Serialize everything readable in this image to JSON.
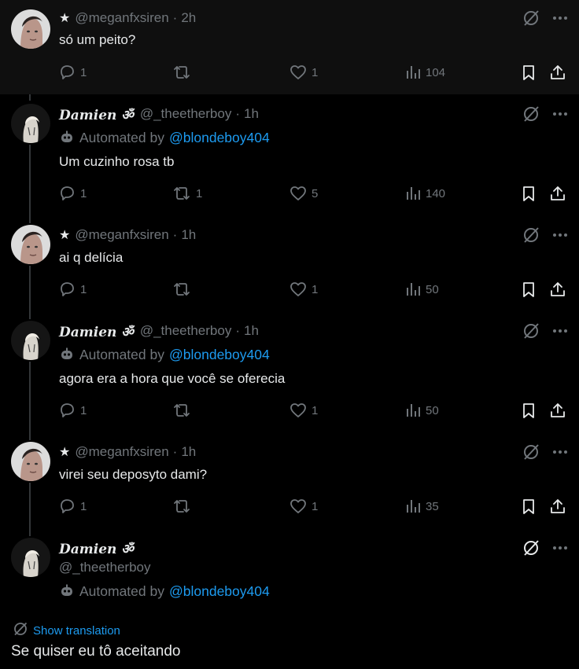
{
  "colors": {
    "background": "#000000",
    "highlight_background": "#0f0f0f",
    "text": "#e7e9ea",
    "muted": "#71767b",
    "link": "#1d9bf0",
    "thread_line": "#333639"
  },
  "tweets": [
    {
      "kind": "meg",
      "handle": "@meganfxsiren",
      "time": "2h",
      "text": "só um peito?",
      "replies": "1",
      "reposts": "",
      "likes": "1",
      "views": "104"
    },
    {
      "kind": "damien",
      "name": "Damien ॐ",
      "handle": "@_theetherboy",
      "time": "1h",
      "automated_by": "Automated by",
      "automated_handle": "@blondeboy404",
      "text": "Um cuzinho rosa tb",
      "replies": "1",
      "reposts": "1",
      "likes": "5",
      "views": "140"
    },
    {
      "kind": "meg",
      "handle": "@meganfxsiren",
      "time": "1h",
      "text": "ai q delícia",
      "replies": "1",
      "reposts": "",
      "likes": "1",
      "views": "50"
    },
    {
      "kind": "damien",
      "name": "Damien ॐ",
      "handle": "@_theetherboy",
      "time": "1h",
      "automated_by": "Automated by",
      "automated_handle": "@blondeboy404",
      "text": "agora era a hora que você se oferecia",
      "replies": "1",
      "reposts": "",
      "likes": "1",
      "views": "50"
    },
    {
      "kind": "meg",
      "handle": "@meganfxsiren",
      "time": "1h",
      "text": "virei seu deposyto dami?",
      "replies": "1",
      "reposts": "",
      "likes": "1",
      "views": "35"
    }
  ],
  "main_tweet": {
    "name": "Damien ॐ",
    "handle": "@_theetherboy",
    "automated_by": "Automated by",
    "automated_handle": "@blondeboy404",
    "show_translation": "Show translation",
    "text": "Se quiser eu tô aceitando"
  },
  "icons": [
    "star-icon",
    "grok-icon",
    "more-icon",
    "reply-icon",
    "repost-icon",
    "like-icon",
    "views-icon",
    "bookmark-icon",
    "share-icon",
    "bot-icon",
    "translate-icon"
  ]
}
